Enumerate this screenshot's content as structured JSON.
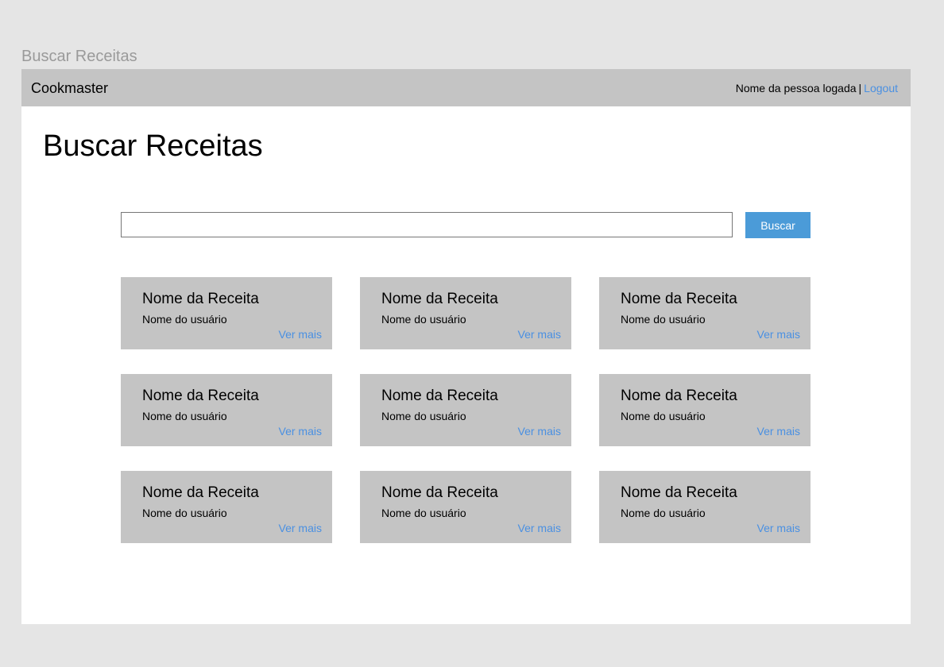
{
  "frame_label": "Buscar Receitas",
  "header": {
    "brand": "Cookmaster",
    "user_name": "Nome da pessoa logada",
    "separator": "|",
    "logout_label": "Logout"
  },
  "main": {
    "title": "Buscar Receitas",
    "search": {
      "value": "",
      "placeholder": "",
      "button_label": "Buscar"
    },
    "recipes": [
      {
        "name": "Nome da Receita",
        "user": "Nome do usuário",
        "link": "Ver mais"
      },
      {
        "name": "Nome da Receita",
        "user": "Nome do usuário",
        "link": "Ver mais"
      },
      {
        "name": "Nome da Receita",
        "user": "Nome do usuário",
        "link": "Ver mais"
      },
      {
        "name": "Nome da Receita",
        "user": "Nome do usuário",
        "link": "Ver mais"
      },
      {
        "name": "Nome da Receita",
        "user": "Nome do usuário",
        "link": "Ver mais"
      },
      {
        "name": "Nome da Receita",
        "user": "Nome do usuário",
        "link": "Ver mais"
      },
      {
        "name": "Nome da Receita",
        "user": "Nome do usuário",
        "link": "Ver mais"
      },
      {
        "name": "Nome da Receita",
        "user": "Nome do usuário",
        "link": "Ver mais"
      },
      {
        "name": "Nome da Receita",
        "user": "Nome do usuário",
        "link": "Ver mais"
      }
    ]
  },
  "colors": {
    "background": "#e5e5e5",
    "panel": "#ffffff",
    "bar": "#c4c4c4",
    "card": "#c4c4c4",
    "link": "#4a90e2",
    "button": "#4b9bd8",
    "frame_label": "#9a9a9a"
  }
}
